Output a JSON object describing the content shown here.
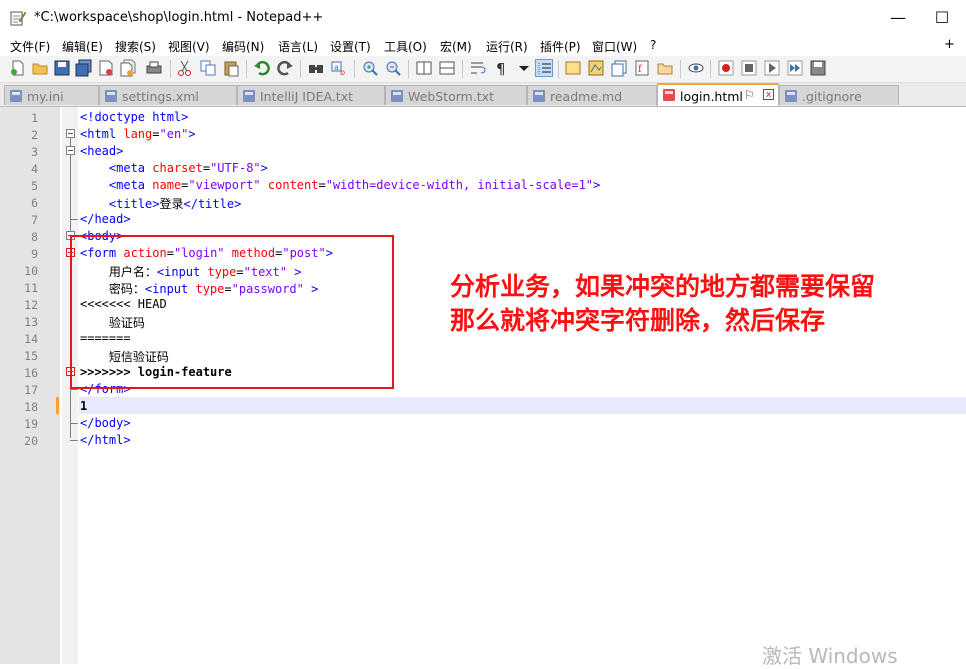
{
  "window": {
    "title": "*C:\\workspace\\shop\\login.html - Notepad++",
    "minimize": "—",
    "maximize": "☐"
  },
  "menu": {
    "items": [
      "文件(F)",
      "编辑(E)",
      "搜索(S)",
      "视图(V)",
      "编码(N)",
      "语言(L)",
      "设置(T)",
      "工具(O)",
      "宏(M)",
      "运行(R)",
      "插件(P)",
      "窗口(W)",
      "?"
    ],
    "plus": "+"
  },
  "tabs": [
    {
      "label": "my.ini",
      "active": false
    },
    {
      "label": "settings.xml",
      "active": false
    },
    {
      "label": "IntelliJ IDEA.txt",
      "active": false
    },
    {
      "label": "WebStorm.txt",
      "active": false
    },
    {
      "label": "readme.md",
      "active": false
    },
    {
      "label": "login.html",
      "active": true
    },
    {
      "label": ".gitignore",
      "active": false
    }
  ],
  "editor": {
    "line_numbers": [
      "1",
      "2",
      "3",
      "4",
      "5",
      "6",
      "7",
      "8",
      "9",
      "10",
      "11",
      "12",
      "13",
      "14",
      "15",
      "16",
      "17",
      "18",
      "19",
      "20"
    ],
    "current_line": 18
  },
  "annotation": {
    "line1": "分析业务，如果冲突的地方都需要保留",
    "line2": "那么就将冲突字符删除，然后保存"
  },
  "watermark": "激活 Windows",
  "colors": {
    "annotation": "#ff1010",
    "box": "#e8161a",
    "tag": "#0000ff",
    "attr": "#ff0000",
    "string": "#8000ff",
    "active_tab_accent": "#f7a23b"
  }
}
